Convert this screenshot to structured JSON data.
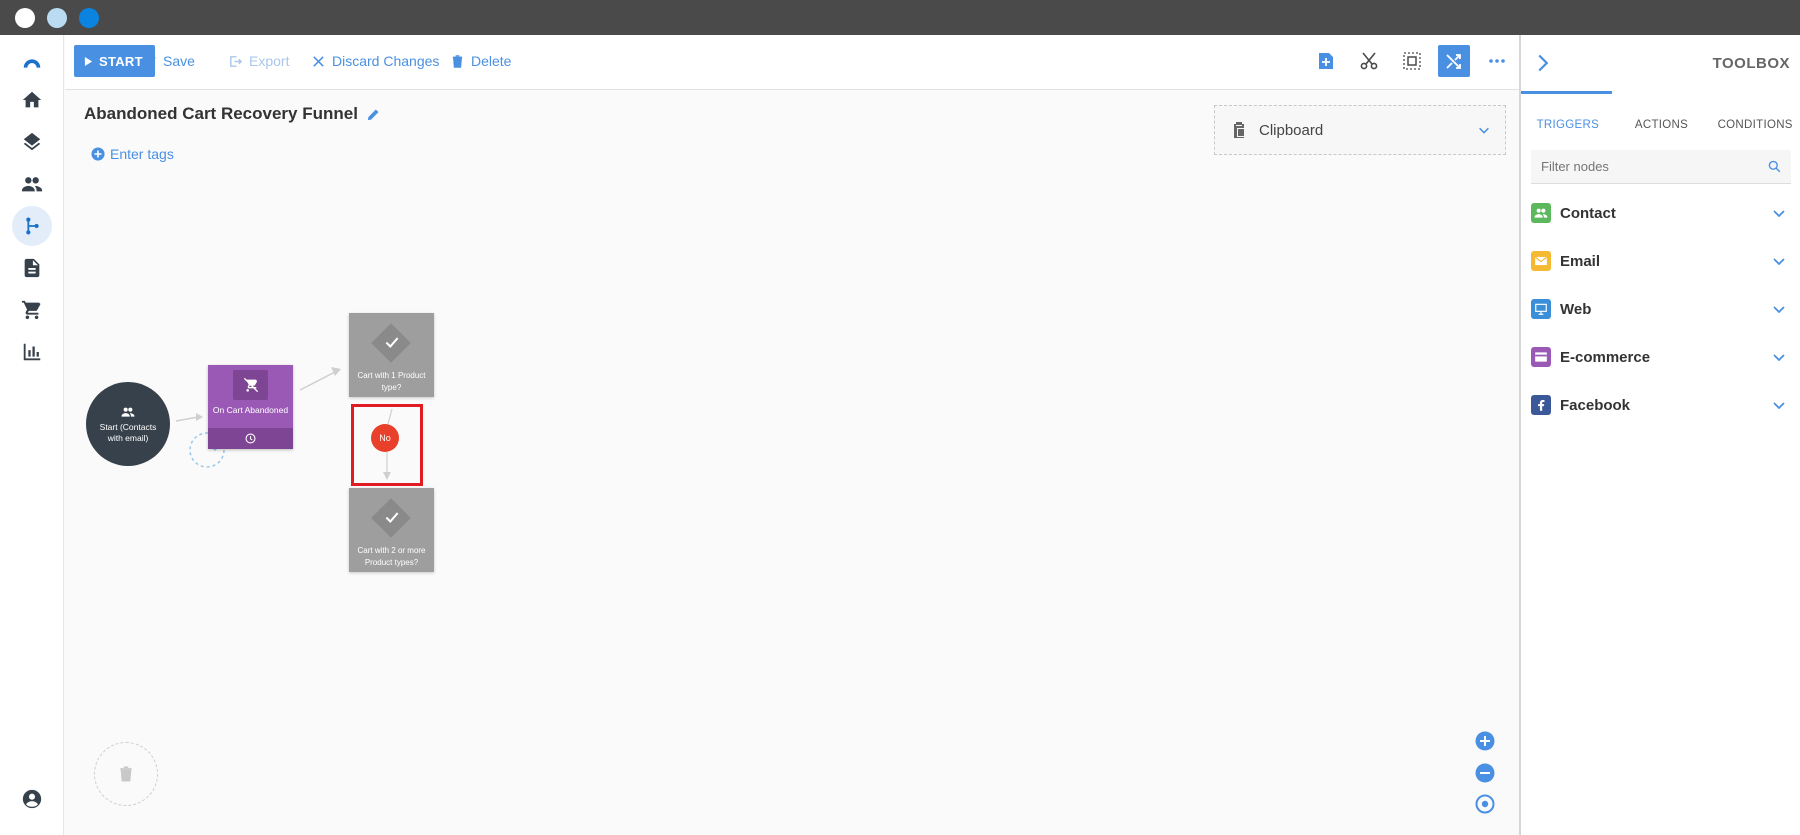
{
  "toolbar": {
    "start_label": "START",
    "save_label": "Save",
    "export_label": "Export",
    "discard_label": "Discard Changes",
    "delete_label": "Delete"
  },
  "funnel": {
    "title": "Abandoned Cart Recovery Funnel",
    "tags_label": "Enter tags"
  },
  "clipboard": {
    "label": "Clipboard"
  },
  "flow": {
    "start_label": "Start (Contacts with email)",
    "trigger_label": "On Cart Abandoned",
    "condition_1_label": "Cart with 1 Product type?",
    "condition_2_label": "Cart with 2 or more Product types?",
    "no_label": "No"
  },
  "toolbox": {
    "title": "TOOLBOX",
    "tabs": [
      {
        "label": "TRIGGERS",
        "active": true
      },
      {
        "label": "ACTIONS",
        "active": false
      },
      {
        "label": "CONDITIONS",
        "active": false
      }
    ],
    "filter_placeholder": "Filter nodes",
    "categories": [
      {
        "label": "Contact",
        "color": "#5cb85c",
        "icon": "people-icon"
      },
      {
        "label": "Email",
        "color": "#f5b932",
        "icon": "envelope-icon"
      },
      {
        "label": "Web",
        "color": "#3a8fd8",
        "icon": "monitor-icon"
      },
      {
        "label": "E-commerce",
        "color": "#9b59b6",
        "icon": "card-icon"
      },
      {
        "label": "Facebook",
        "color": "#3b5998",
        "icon": "facebook-icon"
      }
    ]
  },
  "colors": {
    "accent": "#4a90e2",
    "trigger": "#9b59b6",
    "condition": "#9e9e9e",
    "start_node": "#37414b",
    "no_badge": "#e8402a",
    "highlight": "#e01b22"
  }
}
